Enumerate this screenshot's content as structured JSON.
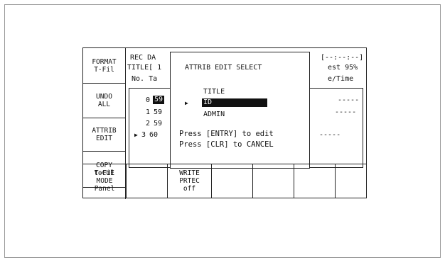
{
  "side_buttons": [
    {
      "line1": "FORMAT",
      "line2": "T-Fil"
    },
    {
      "line1": "UNDO",
      "line2": "ALL"
    },
    {
      "line1": "ATTRIB",
      "line2": "EDIT"
    },
    {
      "line1": "COPY",
      "line2": "toCUE"
    }
  ],
  "bottom_buttons": [
    {
      "line1": "T-Fil",
      "line2": "MODE",
      "line3": "Panel"
    },
    {
      "line1": "",
      "line2": "",
      "line3": ""
    },
    {
      "line1": "WRITE",
      "line2": "PRTEC",
      "line3": "off"
    },
    {
      "line1": "",
      "line2": "",
      "line3": ""
    },
    {
      "line1": "",
      "line2": "",
      "line3": ""
    },
    {
      "line1": "",
      "line2": "",
      "line3": ""
    }
  ],
  "header": {
    "rec_date": "REC DA",
    "title": "TITLE[ 1",
    "no_tape": "No. Ta",
    "right_line1": "[--:--:--]",
    "right_line2": "est 95%",
    "right_line3": "e/Time"
  },
  "rows": [
    {
      "marker": "",
      "prefix": "0",
      "id": "59",
      "dashes": "-----"
    },
    {
      "marker": "",
      "prefix": "1",
      "id": "59",
      "dashes": "-----"
    },
    {
      "marker": "",
      "prefix": "2",
      "id": "59",
      "dashes": ""
    },
    {
      "marker": "▶",
      "prefix": "3",
      "id": "60",
      "dashes": "-----"
    }
  ],
  "dialog": {
    "title": "ATTRIB EDIT SELECT",
    "options": [
      "TITLE",
      "ID",
      "ADMIN"
    ],
    "selected_index": 1,
    "selector": "▶",
    "hint_line1": "Press [ENTRY] to edit",
    "hint_line2": "Press [CLR] to CANCEL"
  }
}
